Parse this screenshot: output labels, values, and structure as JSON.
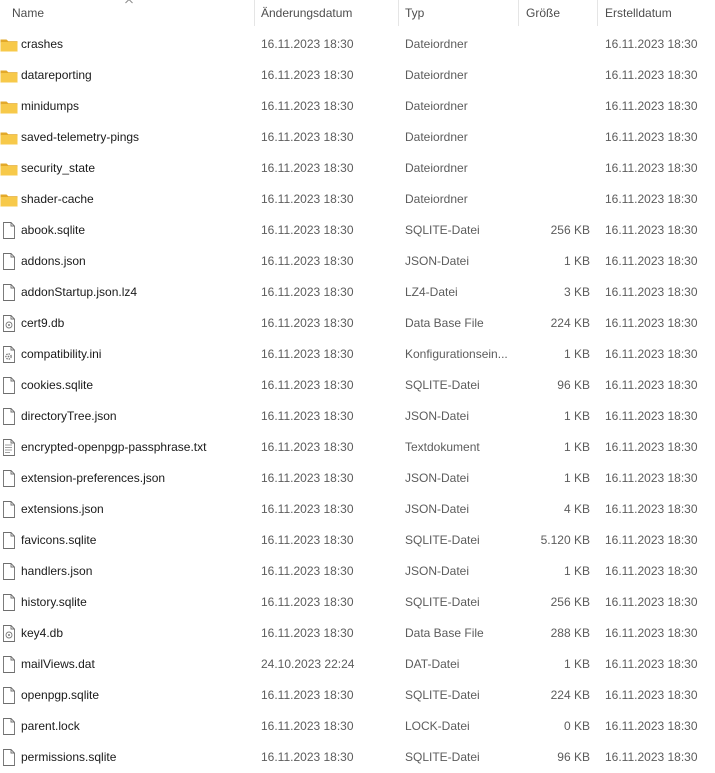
{
  "columns": {
    "name": "Name",
    "modified": "Änderungsdatum",
    "type": "Typ",
    "size": "Größe",
    "created": "Erstelldatum"
  },
  "colors": {
    "folder": "#f7c94a",
    "folder_dark": "#e3a92a",
    "file_border": "#6e6e6e"
  },
  "files": [
    {
      "name": "crashes",
      "modified": "16.11.2023 18:30",
      "type": "Dateiordner",
      "size": "",
      "created": "16.11.2023 18:30",
      "icon": "folder-icon"
    },
    {
      "name": "datareporting",
      "modified": "16.11.2023 18:30",
      "type": "Dateiordner",
      "size": "",
      "created": "16.11.2023 18:30",
      "icon": "folder-icon"
    },
    {
      "name": "minidumps",
      "modified": "16.11.2023 18:30",
      "type": "Dateiordner",
      "size": "",
      "created": "16.11.2023 18:30",
      "icon": "folder-icon"
    },
    {
      "name": "saved-telemetry-pings",
      "modified": "16.11.2023 18:30",
      "type": "Dateiordner",
      "size": "",
      "created": "16.11.2023 18:30",
      "icon": "folder-icon"
    },
    {
      "name": "security_state",
      "modified": "16.11.2023 18:30",
      "type": "Dateiordner",
      "size": "",
      "created": "16.11.2023 18:30",
      "icon": "folder-icon"
    },
    {
      "name": "shader-cache",
      "modified": "16.11.2023 18:30",
      "type": "Dateiordner",
      "size": "",
      "created": "16.11.2023 18:30",
      "icon": "folder-icon"
    },
    {
      "name": "abook.sqlite",
      "modified": "16.11.2023 18:30",
      "type": "SQLITE-Datei",
      "size": "256 KB",
      "created": "16.11.2023 18:30",
      "icon": "file-icon"
    },
    {
      "name": "addons.json",
      "modified": "16.11.2023 18:30",
      "type": "JSON-Datei",
      "size": "1 KB",
      "created": "16.11.2023 18:30",
      "icon": "file-icon"
    },
    {
      "name": "addonStartup.json.lz4",
      "modified": "16.11.2023 18:30",
      "type": "LZ4-Datei",
      "size": "3 KB",
      "created": "16.11.2023 18:30",
      "icon": "file-icon"
    },
    {
      "name": "cert9.db",
      "modified": "16.11.2023 18:30",
      "type": "Data Base File",
      "size": "224 KB",
      "created": "16.11.2023 18:30",
      "icon": "database-file-icon"
    },
    {
      "name": "compatibility.ini",
      "modified": "16.11.2023 18:30",
      "type": "Konfigurationsein...",
      "size": "1 KB",
      "created": "16.11.2023 18:30",
      "icon": "config-file-icon"
    },
    {
      "name": "cookies.sqlite",
      "modified": "16.11.2023 18:30",
      "type": "SQLITE-Datei",
      "size": "96 KB",
      "created": "16.11.2023 18:30",
      "icon": "file-icon"
    },
    {
      "name": "directoryTree.json",
      "modified": "16.11.2023 18:30",
      "type": "JSON-Datei",
      "size": "1 KB",
      "created": "16.11.2023 18:30",
      "icon": "file-icon"
    },
    {
      "name": "encrypted-openpgp-passphrase.txt",
      "modified": "16.11.2023 18:30",
      "type": "Textdokument",
      "size": "1 KB",
      "created": "16.11.2023 18:30",
      "icon": "text-file-icon"
    },
    {
      "name": "extension-preferences.json",
      "modified": "16.11.2023 18:30",
      "type": "JSON-Datei",
      "size": "1 KB",
      "created": "16.11.2023 18:30",
      "icon": "file-icon"
    },
    {
      "name": "extensions.json",
      "modified": "16.11.2023 18:30",
      "type": "JSON-Datei",
      "size": "4 KB",
      "created": "16.11.2023 18:30",
      "icon": "file-icon"
    },
    {
      "name": "favicons.sqlite",
      "modified": "16.11.2023 18:30",
      "type": "SQLITE-Datei",
      "size": "5.120 KB",
      "created": "16.11.2023 18:30",
      "icon": "file-icon"
    },
    {
      "name": "handlers.json",
      "modified": "16.11.2023 18:30",
      "type": "JSON-Datei",
      "size": "1 KB",
      "created": "16.11.2023 18:30",
      "icon": "file-icon"
    },
    {
      "name": "history.sqlite",
      "modified": "16.11.2023 18:30",
      "type": "SQLITE-Datei",
      "size": "256 KB",
      "created": "16.11.2023 18:30",
      "icon": "file-icon"
    },
    {
      "name": "key4.db",
      "modified": "16.11.2023 18:30",
      "type": "Data Base File",
      "size": "288 KB",
      "created": "16.11.2023 18:30",
      "icon": "database-file-icon"
    },
    {
      "name": "mailViews.dat",
      "modified": "24.10.2023 22:24",
      "type": "DAT-Datei",
      "size": "1 KB",
      "created": "16.11.2023 18:30",
      "icon": "file-icon"
    },
    {
      "name": "openpgp.sqlite",
      "modified": "16.11.2023 18:30",
      "type": "SQLITE-Datei",
      "size": "224 KB",
      "created": "16.11.2023 18:30",
      "icon": "file-icon"
    },
    {
      "name": "parent.lock",
      "modified": "16.11.2023 18:30",
      "type": "LOCK-Datei",
      "size": "0 KB",
      "created": "16.11.2023 18:30",
      "icon": "file-icon"
    },
    {
      "name": "permissions.sqlite",
      "modified": "16.11.2023 18:30",
      "type": "SQLITE-Datei",
      "size": "96 KB",
      "created": "16.11.2023 18:30",
      "icon": "file-icon"
    }
  ]
}
